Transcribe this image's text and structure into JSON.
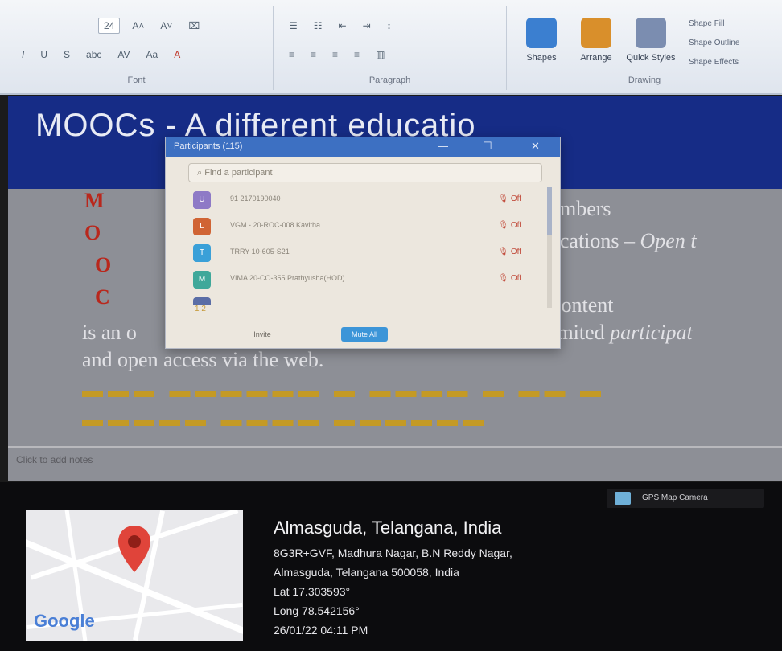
{
  "ribbon": {
    "font_size_value": "24",
    "font_group_label": "Font",
    "paragraph_group_label": "Paragraph",
    "drawing_group_label": "Drawing",
    "shapes_label": "Shapes",
    "arrange_label": "Arrange",
    "quick_styles_label": "Quick Styles",
    "shape_fill_label": "Shape Fill",
    "shape_outline_label": "Shape Outline",
    "shape_effects_label": "Shape Effects"
  },
  "slide": {
    "title": "MOOCs -  A different educatio",
    "letters": [
      "M",
      "O",
      "O",
      "C"
    ],
    "line1_right": "numbers",
    "line2_right_roman": "fications – ",
    "line2_right_italic": "Open t",
    "line4_right": "content",
    "line5_left": "is an o",
    "line5_right_roman": "limited ",
    "line5_right_italic": "participat",
    "line6": "and open access via the web.",
    "notes_placeholder": "Click to add notes"
  },
  "dialog": {
    "title": "Participants (115)",
    "search_placeholder": "Find a participant",
    "participants": [
      {
        "name": "91 2170190040",
        "avatar": "U",
        "status": "Off"
      },
      {
        "name": "VGM - 20-ROC-008 Kavitha",
        "avatar": "L",
        "status": "Off"
      },
      {
        "name": "TRRY 10-605-S21",
        "avatar": "T",
        "status": "Off"
      },
      {
        "name": "VIMA 20-CO-355 Prathyusha(HOD)",
        "avatar": "M",
        "status": "Off"
      }
    ],
    "more_text": "1 2",
    "button_left": "Invite",
    "button_right": "Mute All"
  },
  "gps": {
    "badge": "GPS Map Camera",
    "map_brand": "Google",
    "location_title": "Almasguda, Telangana, India",
    "address_line1": "8G3R+GVF, Madhura Nagar, B.N Reddy Nagar,",
    "address_line2": "Almasguda, Telangana 500058, India",
    "lat": "Lat 17.303593°",
    "long": "Long 78.542156°",
    "datetime": "26/01/22 04:11 PM"
  },
  "colors": {
    "slide_band": "#162c86",
    "accent_letters": "#b9271c",
    "dialog_titlebar": "#3d70c2",
    "map_pin": "#e0443a"
  }
}
